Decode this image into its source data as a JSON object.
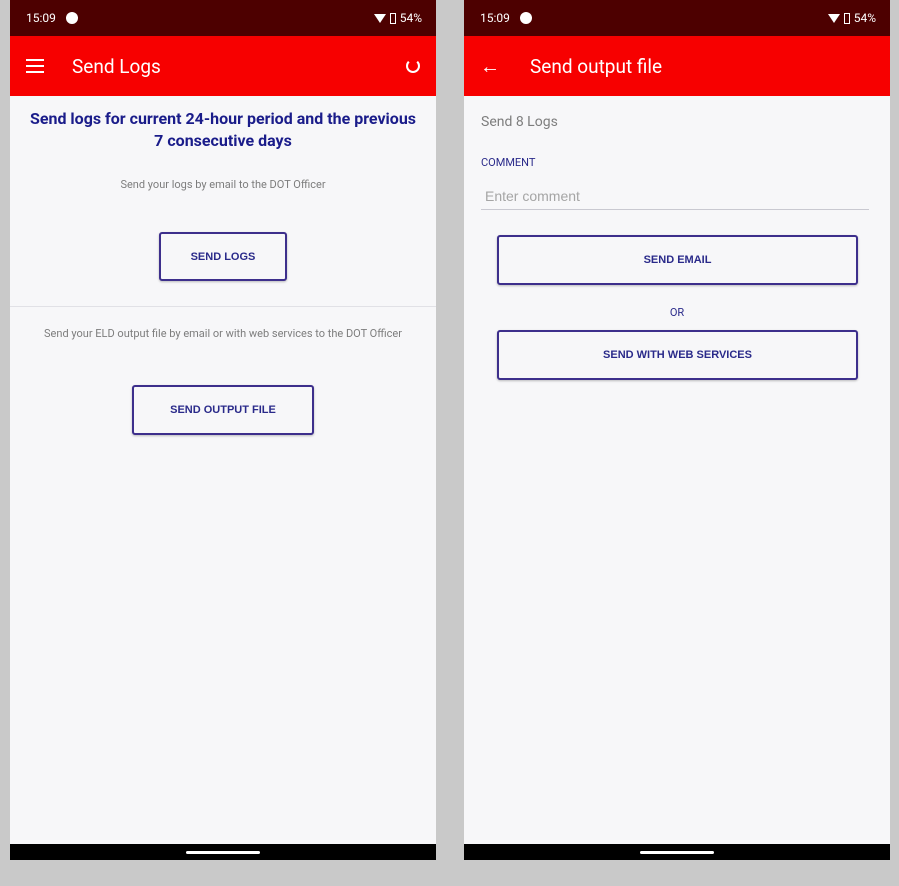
{
  "left": {
    "status": {
      "time": "15:09",
      "battery": "54%"
    },
    "appbar": {
      "title": "Send Logs"
    },
    "headline": "Send logs for current 24-hour period and the previous 7 consecutive days",
    "email_note": "Send your logs by email to the DOT Officer",
    "send_logs_label": "SEND LOGS",
    "output_note": "Send your ELD output file by email or with web services to the DOT Officer",
    "send_output_label": "SEND OUTPUT FILE"
  },
  "right": {
    "status": {
      "time": "15:09",
      "battery": "54%"
    },
    "appbar": {
      "title": "Send output file"
    },
    "field_title": "Send 8 Logs",
    "comment_label": "COMMENT",
    "comment_placeholder": "Enter comment",
    "comment_value": "",
    "send_email_label": "SEND EMAIL",
    "or_label": "OR",
    "send_web_label": "SEND WITH WEB SERVICES"
  }
}
